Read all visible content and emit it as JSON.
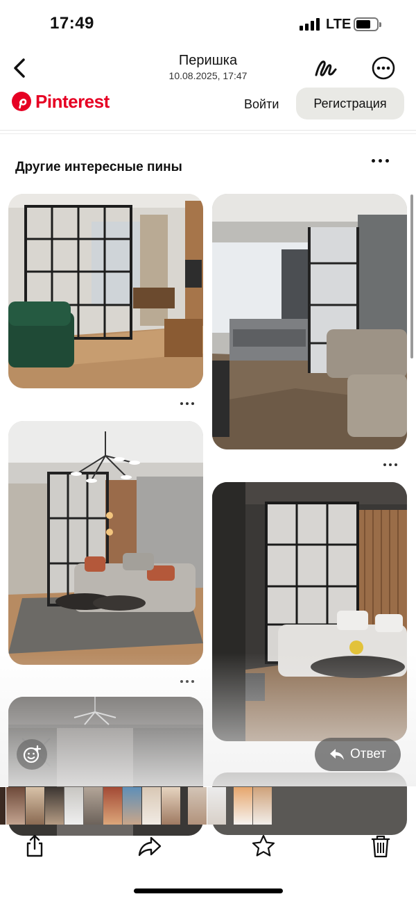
{
  "status_bar": {
    "time": "17:49",
    "network": "LTE"
  },
  "nav": {
    "title": "Перишка",
    "subtitle": "10.08.2025, 17:47"
  },
  "pinterest": {
    "brand": "Pinterest",
    "login_label": "Войти",
    "register_label": "Регистрация",
    "brand_color": "#e60023"
  },
  "section": {
    "title": "Другие интересные пины"
  },
  "pins": [
    {
      "icon": "room-photo-green-sofa"
    },
    {
      "icon": "room-photo-bedroom-partition"
    },
    {
      "icon": "room-photo-living-room-lamp"
    },
    {
      "icon": "room-photo-corner-sofa"
    },
    {
      "icon": "room-photo-dark-interior"
    }
  ],
  "overlay": {
    "reply_label": "Ответ"
  },
  "toolbar": {
    "icons": [
      "share-icon",
      "forward-icon",
      "star-icon",
      "trash-icon"
    ]
  }
}
